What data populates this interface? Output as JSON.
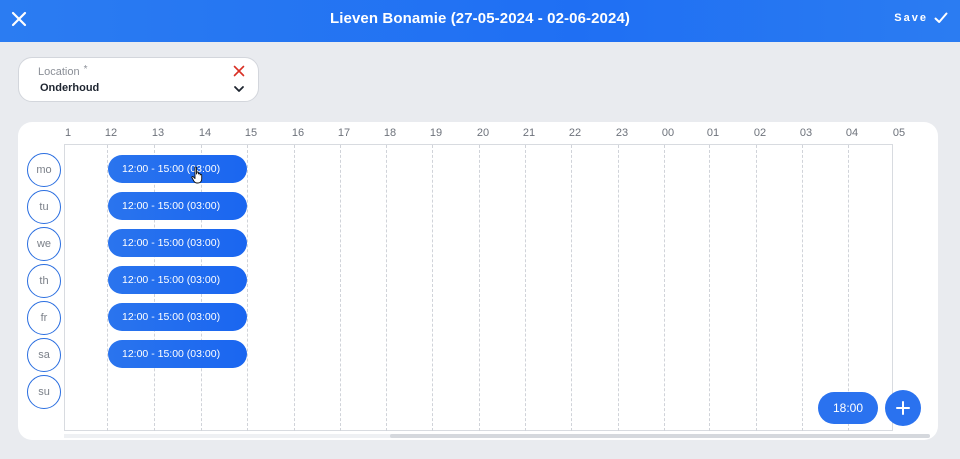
{
  "header": {
    "title": "Lieven Bonamie (27-05-2024 - 02-06-2024)",
    "save_label": "Save",
    "close_icon": "close-icon",
    "save_icon": "check-icon"
  },
  "location": {
    "label": "Location",
    "required_mark": "*",
    "value": "Onderhoud",
    "clear_icon": "x-icon",
    "dropdown_icon": "chevron-down-icon"
  },
  "schedule": {
    "hours": [
      "1",
      "12",
      "13",
      "14",
      "15",
      "16",
      "17",
      "18",
      "19",
      "20",
      "21",
      "22",
      "23",
      "00",
      "01",
      "02",
      "03",
      "04",
      "05"
    ],
    "days": [
      "mo",
      "tu",
      "we",
      "th",
      "fr",
      "sa",
      "su"
    ],
    "shifts": [
      {
        "day": "mo",
        "label": "12:00 - 15:00 (03:00)"
      },
      {
        "day": "tu",
        "label": "12:00 - 15:00 (03:00)"
      },
      {
        "day": "we",
        "label": "12:00 - 15:00 (03:00)"
      },
      {
        "day": "th",
        "label": "12:00 - 15:00 (03:00)"
      },
      {
        "day": "fr",
        "label": "12:00 - 15:00 (03:00)"
      },
      {
        "day": "sa",
        "label": "12:00 - 15:00 (03:00)"
      }
    ]
  },
  "actions": {
    "time_label": "18:00",
    "add_icon": "plus-icon"
  },
  "colors": {
    "accent": "#2a72ef",
    "header": "#1f6ff3",
    "clear": "#d93025"
  }
}
